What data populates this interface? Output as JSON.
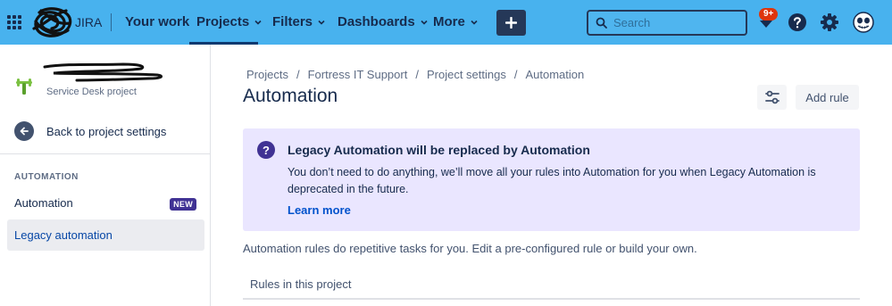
{
  "topbar": {
    "logo_text": "JIRA",
    "nav": {
      "your_work": "Your work",
      "projects": "Projects",
      "filters": "Filters",
      "dashboards": "Dashboards",
      "more": "More"
    },
    "create_label": "+",
    "search_placeholder": "Search",
    "notification_badge": "9+",
    "icons": [
      "app-switcher-icon",
      "notifications-icon",
      "help-icon",
      "settings-icon",
      "avatar"
    ]
  },
  "sidebar": {
    "project_subtitle": "Service Desk project",
    "back_label": "Back to project settings",
    "section_heading": "AUTOMATION",
    "items": [
      {
        "label": "Automation",
        "lozenge": "NEW"
      },
      {
        "label": "Legacy automation"
      }
    ]
  },
  "main": {
    "breadcrumb": [
      "Projects",
      "Fortress IT Support",
      "Project settings",
      "Automation"
    ],
    "breadcrumb_separator": "/",
    "title": "Automation",
    "add_rule_label": "Add rule",
    "banner": {
      "title": "Legacy Automation will be replaced by Automation",
      "body": "You don’t need to do anything, we’ll move all your rules into Automation for you when Legacy Automation is deprecated in the future.",
      "link": "Learn more"
    },
    "intro": "Automation rules do repetitive tasks for you. Edit a pre-configured rule or build your own.",
    "rules_heading": "Rules in this project"
  },
  "colors": {
    "topbar_bg": "#48b2ee",
    "banner_bg": "#eae6ff",
    "lozenge_bg": "#403294",
    "link": "#0052cc",
    "badge": "#de350b"
  }
}
